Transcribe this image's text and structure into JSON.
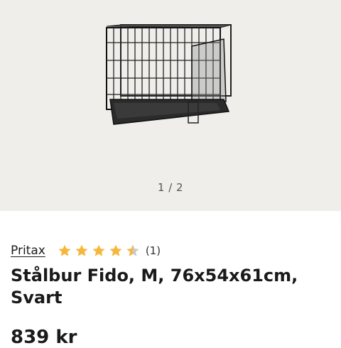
{
  "gallery": {
    "image_alt": "Stålbur Fido cage",
    "pager": "1 / 2"
  },
  "product": {
    "brand": "Pritax",
    "rating": 4.5,
    "rating_max": 5,
    "review_count": "(1)",
    "title": "Stålbur Fido, M, 76x54x61cm, Svart",
    "price": "839 kr"
  },
  "colors": {
    "star": "#f5b83d",
    "star_empty": "#c9c9c9",
    "gallery_bg": "#efeeeb"
  }
}
